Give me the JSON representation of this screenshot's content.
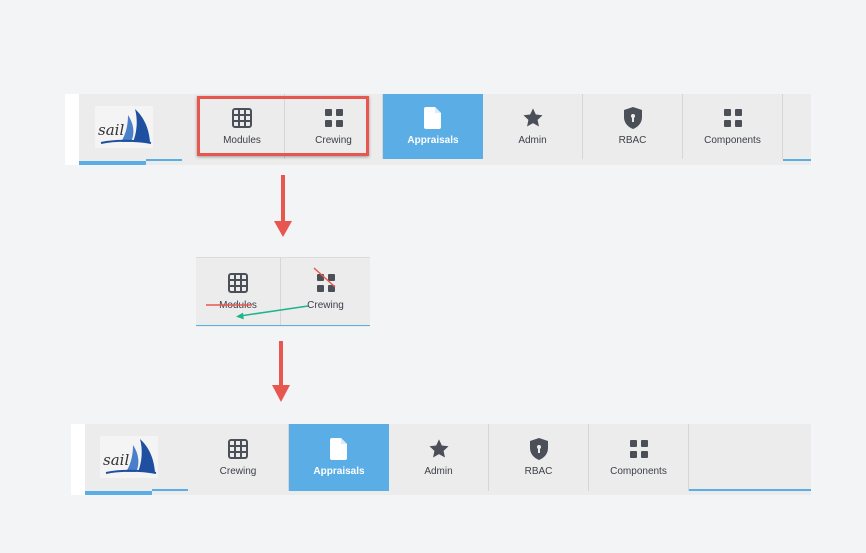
{
  "logo": {
    "text": "sail"
  },
  "nav_before": {
    "tabs": [
      {
        "label": "Modules",
        "icon": "grid-icon"
      },
      {
        "label": "Crewing",
        "icon": "apps-icon"
      },
      {
        "label": "Appraisals",
        "icon": "document-icon",
        "active": true
      },
      {
        "label": "Admin",
        "icon": "star-icon"
      },
      {
        "label": "RBAC",
        "icon": "shield-icon"
      },
      {
        "label": "Components",
        "icon": "apps-icon"
      }
    ]
  },
  "nav_edit": {
    "tabs": [
      {
        "label": "Modules",
        "icon": "grid-icon",
        "struck": true
      },
      {
        "label": "Crewing",
        "icon": "apps-icon",
        "icon_struck": true
      }
    ]
  },
  "nav_after": {
    "tabs": [
      {
        "label": "Crewing",
        "icon": "grid-icon"
      },
      {
        "label": "Appraisals",
        "icon": "document-icon",
        "active": true
      },
      {
        "label": "Admin",
        "icon": "star-icon"
      },
      {
        "label": "RBAC",
        "icon": "shield-icon"
      },
      {
        "label": "Components",
        "icon": "apps-icon"
      }
    ]
  },
  "colors": {
    "accent": "#5aaee5",
    "annotation_red": "#e8574f",
    "annotation_green": "#1fb58c"
  }
}
